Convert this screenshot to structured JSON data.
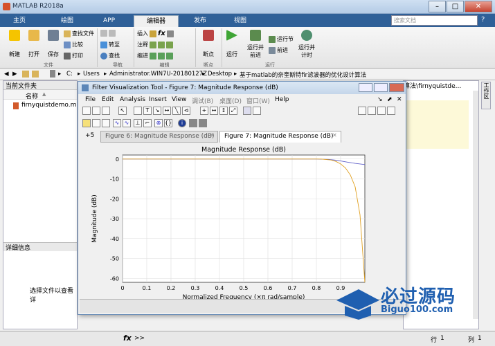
{
  "window": {
    "title": "MATLAB R2018a",
    "min": "–",
    "max": "□",
    "close": "✕"
  },
  "tabs": [
    "主页",
    "绘图",
    "APP",
    "编辑器",
    "发布",
    "视图"
  ],
  "search": {
    "placeholder": "搜索文档"
  },
  "ribbon": {
    "new": "新建",
    "open": "打开",
    "save": "保存",
    "find_files": "查找文件",
    "compare": "比较",
    "print": "打印",
    "goto": "转至",
    "find": "查找",
    "insert": "插入",
    "comment": "注释",
    "indent": "缩进",
    "breakpoints": "断点",
    "run": "运行",
    "run_advance": [
      "运行并",
      "前进"
    ],
    "run_section": "运行节",
    "advance": "前进",
    "run_time": [
      "运行并",
      "计时"
    ],
    "groups": {
      "file": "文件",
      "nav": "导航",
      "edit": "编辑",
      "breakpoints": "断点",
      "run": "运行"
    },
    "fx": "fx"
  },
  "address": {
    "parts": [
      "C:",
      "Users",
      "Administrator.WIN7U-20180127Z",
      "Desktop",
      "基于matlab的奈奎斯特fir滤波器的优化设计算法"
    ]
  },
  "left": {
    "header": "当前文件夹",
    "col": "名称",
    "sort": "▲",
    "file": "firnyquistdemo.m",
    "details": "详细信息",
    "hint": "选择文件以查看详"
  },
  "right": {
    "text": "算法\\firnyquistde...",
    "side": "工作区"
  },
  "figure": {
    "title": "Filter Visualization Tool - Figure 7: Magnitude Response (dB)",
    "menu": [
      "File",
      "Edit",
      "Analysis",
      "Insert",
      "View",
      "调试(B)",
      "桌面(D)",
      "窗口(W)",
      "Help"
    ],
    "tabs": [
      "+5",
      "Figure 6: Magnitude Response (dB)",
      "Figure 7: Magnitude Response (dB)"
    ]
  },
  "status": {
    "prompt": ">>",
    "fx": "fx",
    "row_label": "行",
    "row": "1",
    "col_label": "列",
    "col": "1"
  },
  "watermark": {
    "main": "必过源码",
    "url": "Biguo100.com"
  },
  "chart_data": {
    "type": "line",
    "title": "Magnitude Response (dB)",
    "xlabel": "Normalized Frequency (×π rad/sample)",
    "ylabel": "Magnitude (dB)",
    "xlim": [
      0,
      1
    ],
    "ylim": [
      -62,
      2
    ],
    "xticks": [
      0,
      0.1,
      0.2,
      0.3,
      0.4,
      0.5,
      0.6,
      0.7,
      0.8,
      0.9
    ],
    "yticks": [
      0,
      -10,
      -20,
      -30,
      -40,
      -50,
      -60
    ],
    "grid": true,
    "series": [
      {
        "color": "#6060c8",
        "x": [
          0,
          0.8,
          0.85,
          0.88,
          0.9,
          0.93,
          0.96,
          1.0
        ],
        "y": [
          0,
          0,
          -0.2,
          -0.6,
          -1.0,
          -1.6,
          -2.2,
          -2.8
        ]
      },
      {
        "color": "#e0a020",
        "x": [
          0,
          0.82,
          0.86,
          0.88,
          0.9,
          0.92,
          0.94,
          0.96,
          0.98,
          1.0
        ],
        "y": [
          0,
          0,
          -0.5,
          -1.2,
          -2.5,
          -4.5,
          -8,
          -14,
          -28,
          -62
        ]
      }
    ]
  }
}
